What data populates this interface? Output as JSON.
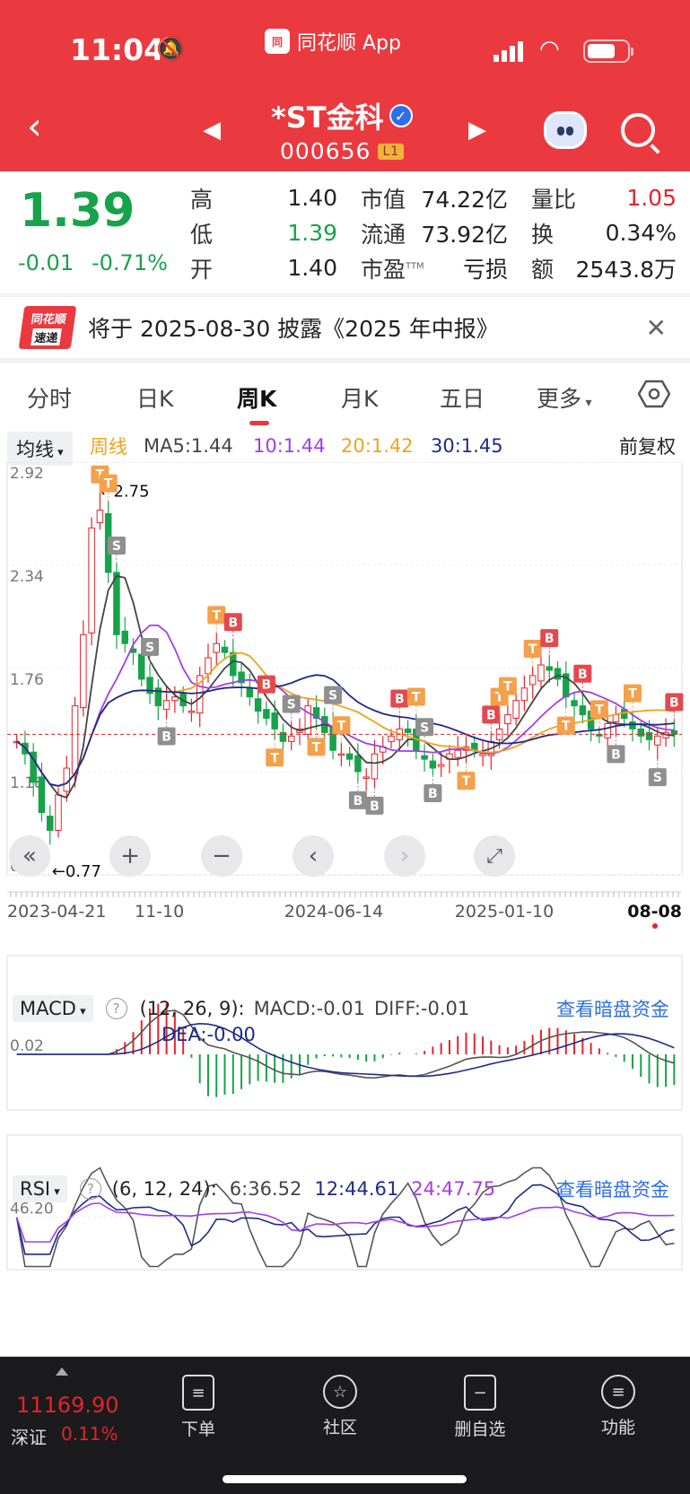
{
  "status_bar": {
    "time": "11:04",
    "source_app": "同花顺 App"
  },
  "header": {
    "stock_name": "*ST金科",
    "stock_code": "000656",
    "level_tag": "L1"
  },
  "quote": {
    "price": "1.39",
    "change": "-0.01",
    "change_pct": "-0.71%",
    "col1": [
      {
        "label": "高",
        "value": "1.40"
      },
      {
        "label": "低",
        "value": "1.39"
      },
      {
        "label": "开",
        "value": "1.40"
      }
    ],
    "col2": [
      {
        "label": "市值",
        "value": "74.22亿"
      },
      {
        "label": "流通",
        "value": "73.92亿"
      },
      {
        "label": "市盈",
        "sup": "TTM",
        "value": "亏损"
      }
    ],
    "col3": [
      {
        "label": "量比",
        "value": "1.05"
      },
      {
        "label": "换",
        "value": "0.34%"
      },
      {
        "label": "额",
        "value": "2543.8万"
      }
    ]
  },
  "notice": {
    "logo_top": "同花顺",
    "logo_bottom": "速递",
    "text": "将于 2025-08-30 披露《2025 年中报》"
  },
  "tabs": [
    "分时",
    "日K",
    "周K",
    "月K",
    "五日",
    "更多"
  ],
  "active_tab": "周K",
  "ma_bar": {
    "select": "均线",
    "period": "周线",
    "ma5": "MA5:1.44",
    "ma10": "10:1.44",
    "ma20": "20:1.42",
    "ma30": "30:1.45",
    "adjust": "前复权"
  },
  "colors": {
    "red": "#e5232b",
    "green": "#16a34a",
    "ma5": "#444444",
    "ma10": "#a33de8",
    "ma20": "#f2a21b",
    "ma30": "#1e2a8a"
  },
  "chart_data": [
    {
      "type": "candlestick",
      "title": "",
      "ylim": [
        0.6,
        2.92
      ],
      "y_ticks": [
        "2.92",
        "2.34",
        "1.76",
        "1.18",
        "0.60"
      ],
      "x_ticks": [
        "2023-04-21",
        "11-10",
        "2024-06-14",
        "2025-01-10",
        "08-08"
      ],
      "annotations": [
        "←2.75",
        "←0.77"
      ],
      "close": [
        1.35,
        1.28,
        1.12,
        0.95,
        0.85,
        1.05,
        1.2,
        1.55,
        1.95,
        2.55,
        2.65,
        2.3,
        1.95,
        1.9,
        1.85,
        1.7,
        1.62,
        1.55,
        1.58,
        1.6,
        1.55,
        1.52,
        1.72,
        1.82,
        1.9,
        1.85,
        1.72,
        1.68,
        1.6,
        1.52,
        1.48,
        1.42,
        1.35,
        1.38,
        1.42,
        1.55,
        1.48,
        1.4,
        1.3,
        1.28,
        1.25,
        1.18,
        1.15,
        1.28,
        1.32,
        1.38,
        1.42,
        1.4,
        1.3,
        1.25,
        1.2,
        1.22,
        1.28,
        1.3,
        1.32,
        1.3,
        1.28,
        1.35,
        1.42,
        1.5,
        1.58,
        1.65,
        1.72,
        1.78,
        1.75,
        1.7,
        1.6,
        1.55,
        1.5,
        1.42,
        1.38,
        1.45,
        1.5,
        1.48,
        1.42,
        1.38,
        1.36,
        1.38,
        1.4,
        1.39
      ],
      "series": [
        {
          "name": "MA5",
          "value": 1.44
        },
        {
          "name": "10",
          "value": 1.44
        },
        {
          "name": "20",
          "value": 1.42
        },
        {
          "name": "30",
          "value": 1.45
        }
      ]
    },
    {
      "type": "bar",
      "title": "MACD",
      "params": "(12, 26, 9):",
      "values_text": {
        "macd": "MACD:-0.01",
        "diff": "DIFF:-0.01",
        "dea": "DEA:-0.00"
      },
      "y_tick": "0.02"
    },
    {
      "type": "line",
      "title": "RSI",
      "params": "(6, 12, 24):",
      "series": [
        {
          "name": "6",
          "value": 36.52
        },
        {
          "name": "12",
          "value": 44.61
        },
        {
          "name": "24",
          "value": 47.75
        }
      ],
      "values_text": {
        "rsi6": "6:36.52",
        "rsi12": "12:44.61",
        "rsi24": "24:47.75"
      },
      "y_tick": "46.20"
    }
  ],
  "indicator_link": "查看暗盘资金",
  "bottom": {
    "index_value": "11169.90",
    "index_name": "深证",
    "index_pct": "0.11%",
    "nav": [
      "下单",
      "社区",
      "删自选",
      "功能"
    ]
  }
}
